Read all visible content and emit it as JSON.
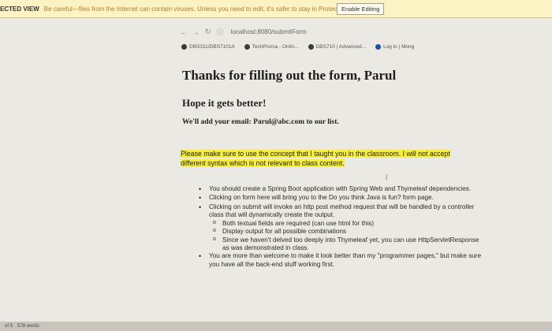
{
  "protected_view": {
    "mode": "ECTED VIEW",
    "message": "Be careful—files from the Internet can contain viruses. Unless you need to edit, it's safer to stay in Protected View.",
    "button": "Enable Editing"
  },
  "browser": {
    "url": "localhost:8080/submitForm",
    "bookmarks": [
      "DBS311/DBS7101A",
      "TechPro/ca - Onlin...",
      "DBS710 | Advanced...",
      "Log in | Mong"
    ]
  },
  "form_result": {
    "heading": "Thanks for filling out the form, Parul",
    "subheading": "Hope it gets better!",
    "email_line": "We'll add your email: Parul@abc.com to our list."
  },
  "instructions": {
    "highlight": "Please make sure to use the concept that I taught you in the classroom. I will not accept different syntax which is not relevant to class content.",
    "bullets": [
      "You should create a Spring Boot application with Spring Web and Thymeleaf dependencies.",
      "Clicking on form here will bring you to the Do you think Java is fun? form page.",
      "Clicking on submit will invoke an http post method request that will be handled by a controller class that will dynamically create the output."
    ],
    "sub_bullets": [
      "Both textual fields are required (can use html for this)",
      "Display output for all possible combinations",
      "Since we haven't delved too deeply into Thymeleaf yet, you can use HttpServletResponse as was demonstrated in class."
    ],
    "last_bullet": "You are more than welcome to make it look better than my \"programmer pages,\" but make sure you have all the back-end stuff working first."
  },
  "status": {
    "page": "of 5",
    "words": "578 words"
  }
}
